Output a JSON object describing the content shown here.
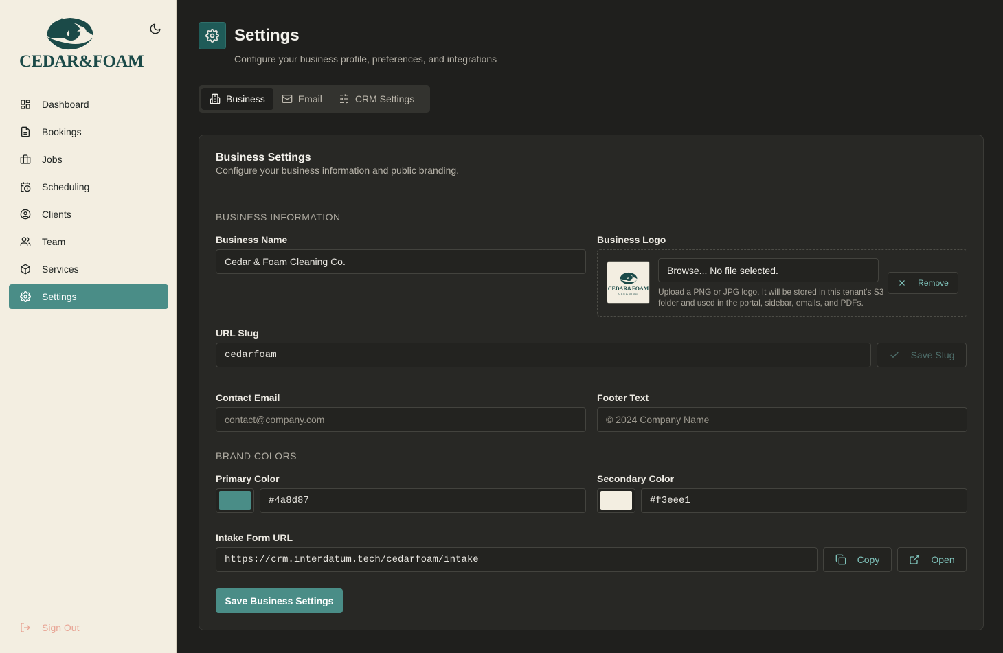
{
  "brand": {
    "logo_text": "CEDAR&FOAM",
    "thumb_text": "CEDAR&FOAM",
    "thumb_sub": "CLEANING",
    "primary": "#4a8d87",
    "dark": "#1b4a48"
  },
  "sidebar": {
    "items": [
      {
        "label": "Dashboard",
        "icon": "dashboard-icon"
      },
      {
        "label": "Bookings",
        "icon": "document-icon"
      },
      {
        "label": "Jobs",
        "icon": "briefcase-icon"
      },
      {
        "label": "Scheduling",
        "icon": "calendar-clock-icon"
      },
      {
        "label": "Clients",
        "icon": "user-circle-icon"
      },
      {
        "label": "Team",
        "icon": "users-icon"
      },
      {
        "label": "Services",
        "icon": "box-icon"
      },
      {
        "label": "Settings",
        "icon": "gear-icon",
        "active": true
      }
    ],
    "sign_out": "Sign Out"
  },
  "header": {
    "title": "Settings",
    "subtitle": "Configure your business profile, preferences, and integrations"
  },
  "tabs": [
    {
      "label": "Business",
      "active": true
    },
    {
      "label": "Email"
    },
    {
      "label": "CRM Settings"
    }
  ],
  "card": {
    "title": "Business Settings",
    "subtitle": "Configure your business information and public branding.",
    "section_info": "BUSINESS INFORMATION",
    "business_name": {
      "label": "Business Name",
      "value": "Cedar & Foam Cleaning Co."
    },
    "business_logo": {
      "label": "Business Logo",
      "file_text": "Browse... No file selected.",
      "help": "Upload a PNG or JPG logo. It will be stored in this tenant's S3 folder and used in the portal, sidebar, emails, and PDFs.",
      "remove_label": "Remove"
    },
    "url_slug": {
      "label": "URL Slug",
      "value": "cedarfoam",
      "save_label": "Save Slug"
    },
    "contact_email": {
      "label": "Contact Email",
      "placeholder": "contact@company.com"
    },
    "footer_text": {
      "label": "Footer Text",
      "placeholder": "© 2024 Company Name"
    },
    "section_colors": "BRAND COLORS",
    "primary_color": {
      "label": "Primary Color",
      "value": "#4a8d87"
    },
    "secondary_color": {
      "label": "Secondary Color",
      "value": "#f3eee1"
    },
    "intake": {
      "label": "Intake Form URL",
      "value": "https://crm.interdatum.tech/cedarfoam/intake",
      "copy_label": "Copy",
      "open_label": "Open"
    },
    "save_label": "Save Business Settings"
  }
}
